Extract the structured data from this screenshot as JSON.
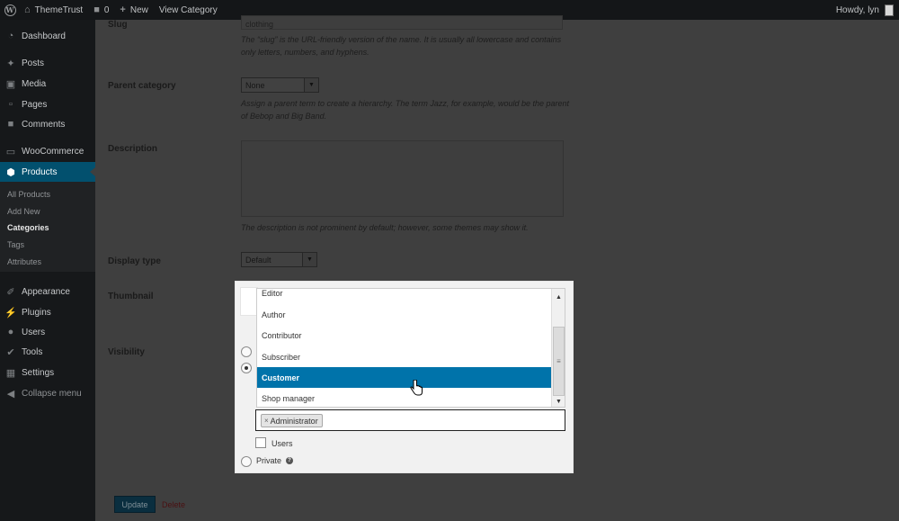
{
  "admin_bar": {
    "site_name": "ThemeTrust",
    "comments_count": "0",
    "new_label": "New",
    "view_label": "View Category",
    "greeting": "Howdy, lyn"
  },
  "menu": {
    "dashboard": "Dashboard",
    "posts": "Posts",
    "media": "Media",
    "pages": "Pages",
    "comments": "Comments",
    "woocommerce": "WooCommerce",
    "products": "Products",
    "submenu": {
      "all_products": "All Products",
      "add_new": "Add New",
      "categories": "Categories",
      "tags": "Tags",
      "attributes": "Attributes"
    },
    "appearance": "Appearance",
    "plugins": "Plugins",
    "users": "Users",
    "tools": "Tools",
    "settings": "Settings",
    "collapse": "Collapse menu"
  },
  "form": {
    "slug_label": "Slug",
    "slug_value": "clothing",
    "slug_desc_1": "The “slug” is the URL-friendly version of the name. It is usually all lowercase and contains",
    "slug_desc_2": "only letters, numbers, and hyphens.",
    "parent_label": "Parent category",
    "parent_value": "None",
    "parent_desc_1": "Assign a parent term to create a hierarchy. The term Jazz, for example, would be the parent",
    "parent_desc_2": "of Bebop and Big Band.",
    "description_label": "Description",
    "description_value": "",
    "description_desc": "The description is not prominent by default; however, some themes may show it.",
    "display_type_label": "Display type",
    "display_type_value": "Default",
    "thumbnail_label": "Thumbnail",
    "visibility_label": "Visibility",
    "update_button": "Update",
    "delete_link": "Delete"
  },
  "visibility_modal": {
    "role_options": [
      "Editor",
      "Author",
      "Contributor",
      "Subscriber",
      "Customer",
      "Shop manager"
    ],
    "highlighted_option": "Customer",
    "selected_roles": [
      "Administrator"
    ],
    "users_label": "Users",
    "private_label": "Private"
  },
  "icons": {
    "wordpress": "wordpress-logo-icon",
    "home": "home-icon",
    "comment": "comment-bubble-icon",
    "plus": "plus-icon",
    "cursor": "hand-pointer-icon"
  },
  "colors": {
    "accent": "#0073aa",
    "menu_bg": "#16181a",
    "admin_bar_bg": "#141618"
  }
}
